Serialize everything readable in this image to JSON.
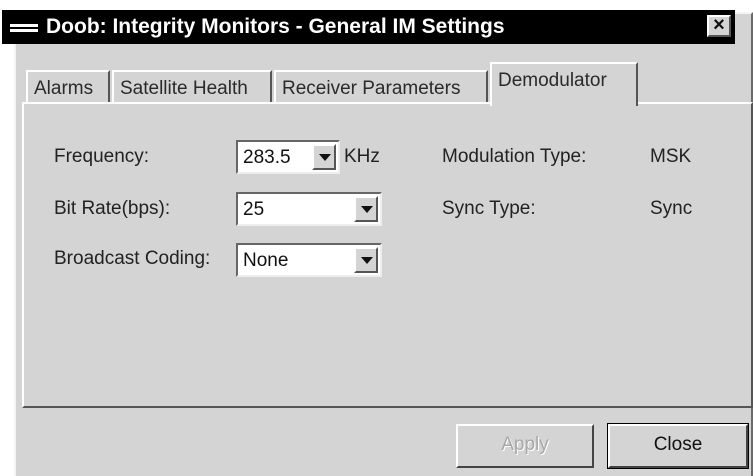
{
  "window": {
    "title": "Doob: Integrity Monitors - General IM Settings",
    "close_glyph": "×"
  },
  "tabs": [
    {
      "label": "Alarms",
      "active": false
    },
    {
      "label": "Satellite Health",
      "active": false
    },
    {
      "label": "Receiver Parameters",
      "active": false
    },
    {
      "label": "Demodulator",
      "active": true
    }
  ],
  "demodulator": {
    "frequency": {
      "label": "Frequency:",
      "value": "283.5",
      "unit": "KHz"
    },
    "bit_rate": {
      "label": "Bit Rate(bps):",
      "value": "25"
    },
    "broadcast_coding": {
      "label": "Broadcast Coding:",
      "value": "None"
    },
    "modulation_type": {
      "label": "Modulation Type:",
      "value": "MSK"
    },
    "sync_type": {
      "label": "Sync Type:",
      "value": "Sync"
    }
  },
  "buttons": {
    "apply": {
      "label": "Apply",
      "enabled": false
    },
    "close": {
      "label": "Close",
      "enabled": true
    }
  },
  "colors": {
    "dialog_face": "#d4d4d4",
    "titlebar": "#000000",
    "title_text": "#ffffff",
    "disabled_text": "#a8a8a8"
  },
  "icons": {
    "system_menu": "system-menu-icon",
    "close": "close-icon",
    "dropdown": "chevron-down-icon"
  }
}
